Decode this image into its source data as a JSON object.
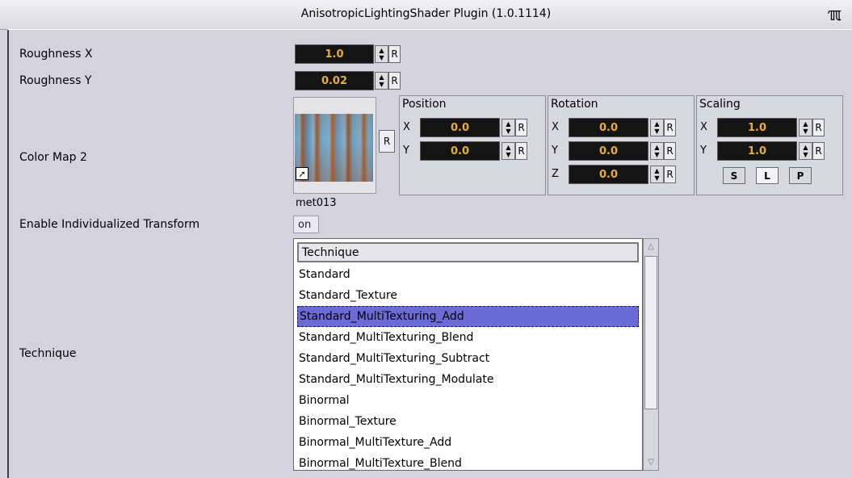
{
  "window": {
    "title": "AnisotropicLightingShader Plugin (1.0.1114)",
    "title_icon_glyph": "ℼ"
  },
  "roughness_x": {
    "label": "Roughness X",
    "value": "1.0",
    "reset": "R"
  },
  "roughness_y": {
    "label": "Roughness Y",
    "value": "0.02",
    "reset": "R"
  },
  "color_map": {
    "label": "Color Map 2",
    "texture_name": "met013",
    "reset": "R",
    "position": {
      "title": "Position",
      "x_label": "X",
      "x_value": "0.0",
      "y_label": "Y",
      "y_value": "0.0",
      "reset": "R"
    },
    "rotation": {
      "title": "Rotation",
      "x_label": "X",
      "x_value": "0.0",
      "y_label": "Y",
      "y_value": "0.0",
      "z_label": "Z",
      "z_value": "0.0",
      "reset": "R"
    },
    "scaling": {
      "title": "Scaling",
      "x_label": "X",
      "x_value": "1.0",
      "y_label": "Y",
      "y_value": "1.0",
      "reset": "R",
      "buttons": [
        "S",
        "L",
        "P"
      ]
    }
  },
  "individual_transform": {
    "label": "Enable Individualized Transform",
    "value": "on"
  },
  "technique": {
    "label": "Technique",
    "header": "Technique",
    "items": [
      "Standard",
      "Standard_Texture",
      "Standard_MultiTexturing_Add",
      "Standard_MultiTexturing_Blend",
      "Standard_MultiTexturing_Subtract",
      "Standard_MultiTexturing_Modulate",
      "Binormal",
      "Binormal_Texture",
      "Binormal_MultiTexture_Add",
      "Binormal_MultiTexture_Blend"
    ],
    "selected_index": 2
  },
  "icons": {
    "spinner": "spinner-arrows-icon",
    "shortcut": "shortcut-arrow-icon",
    "scroll_up": "scroll-up-arrow-icon",
    "scroll_down": "scroll-down-arrow-icon"
  },
  "colors": {
    "field_bg": "#141414",
    "field_text": "#e8b030",
    "selection": "#6b6bd8",
    "panel_bg": "#d4d3dd"
  }
}
